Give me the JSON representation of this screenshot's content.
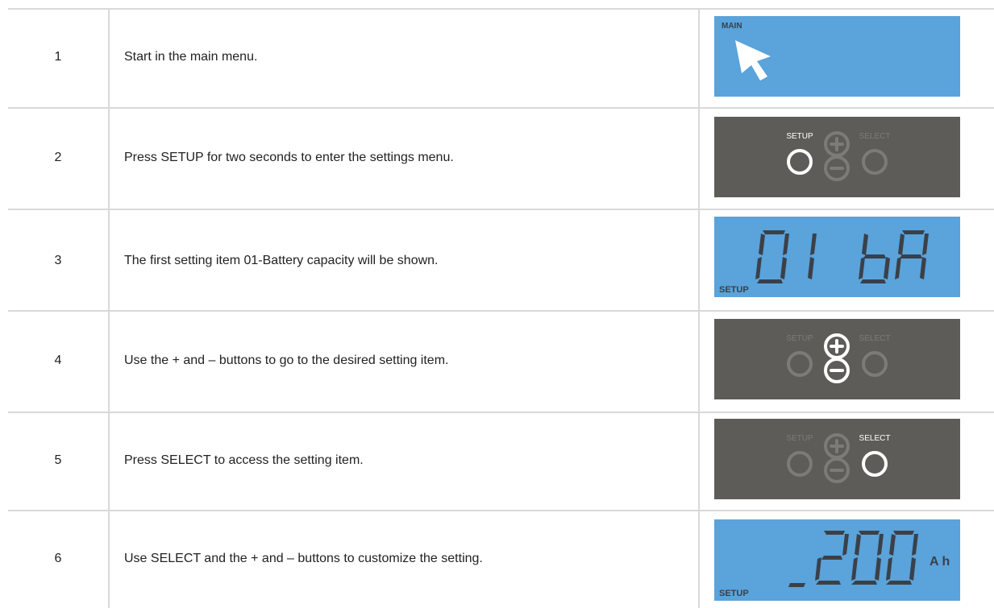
{
  "rows": [
    {
      "num": "1",
      "text": "Start in the main menu.",
      "panel": "lcd",
      "lcd_label": "MAIN",
      "icon": "arrow-cursor-icon"
    },
    {
      "num": "2",
      "text": "Press SETUP for two seconds to enter the settings menu.",
      "panel": "keypad",
      "active": "setup"
    },
    {
      "num": "3",
      "text": "The first setting item 01-Battery capacity will be shown.",
      "panel": "lcd",
      "lcd_value": "01 bA",
      "lcd_label": "SETUP"
    },
    {
      "num": "4",
      "text": "Use the + and – buttons to go to the desired setting item.",
      "panel": "keypad",
      "active": "plusminus"
    },
    {
      "num": "5",
      "text": "Press SELECT to access the setting item.",
      "panel": "keypad",
      "active": "select"
    },
    {
      "num": "6",
      "text": "Use SELECT and the + and – buttons to customize the setting.",
      "panel": "lcd",
      "lcd_value": "_200",
      "lcd_unit": "Ah",
      "lcd_label": "SETUP"
    }
  ],
  "keypad": {
    "setup_label": "SETUP",
    "select_label": "SELECT",
    "plus": "+",
    "minus": "−"
  },
  "colors": {
    "lcd_bg": "#5aa3db",
    "keypad_bg": "#5d5c58",
    "segment": "#3b4048",
    "active": "#ffffff",
    "inactive": "#7c7b78",
    "grid": "#d9d9d9"
  }
}
